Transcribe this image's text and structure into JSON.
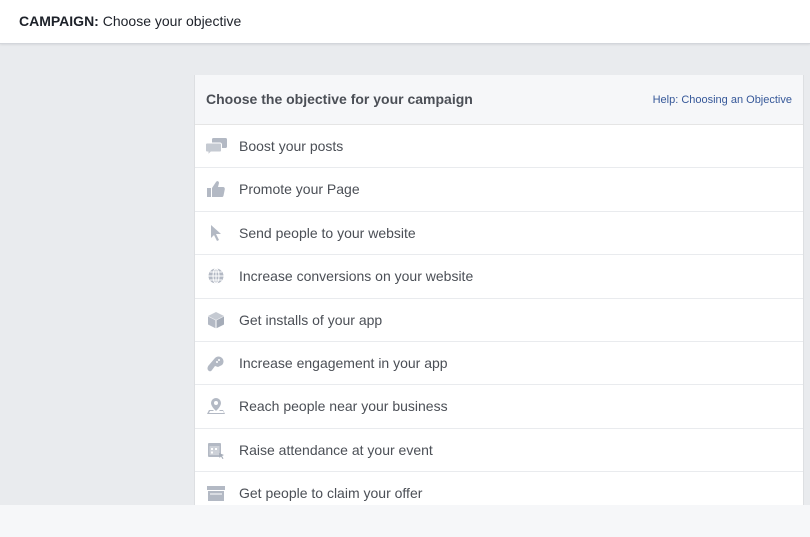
{
  "topbar": {
    "title_strong": "CAMPAIGN:",
    "title_rest": " Choose your objective"
  },
  "panel": {
    "heading": "Choose the objective for your campaign",
    "help_link": "Help: Choosing an Objective",
    "items": [
      {
        "label": "Boost your posts",
        "icon": "speech-bubbles-icon"
      },
      {
        "label": "Promote your Page",
        "icon": "thumbs-up-icon"
      },
      {
        "label": "Send people to your website",
        "icon": "cursor-icon"
      },
      {
        "label": "Increase conversions on your website",
        "icon": "globe-icon"
      },
      {
        "label": "Get installs of your app",
        "icon": "box-icon"
      },
      {
        "label": "Increase engagement in your app",
        "icon": "gamepad-icon"
      },
      {
        "label": "Reach people near your business",
        "icon": "location-pin-icon"
      },
      {
        "label": "Raise attendance at your event",
        "icon": "calendar-icon"
      },
      {
        "label": "Get people to claim your offer",
        "icon": "storefront-icon"
      }
    ]
  },
  "colors": {
    "icon": "#b3b9c4",
    "link": "#365899",
    "text": "#4b4f56",
    "background": "#e9ebee"
  }
}
